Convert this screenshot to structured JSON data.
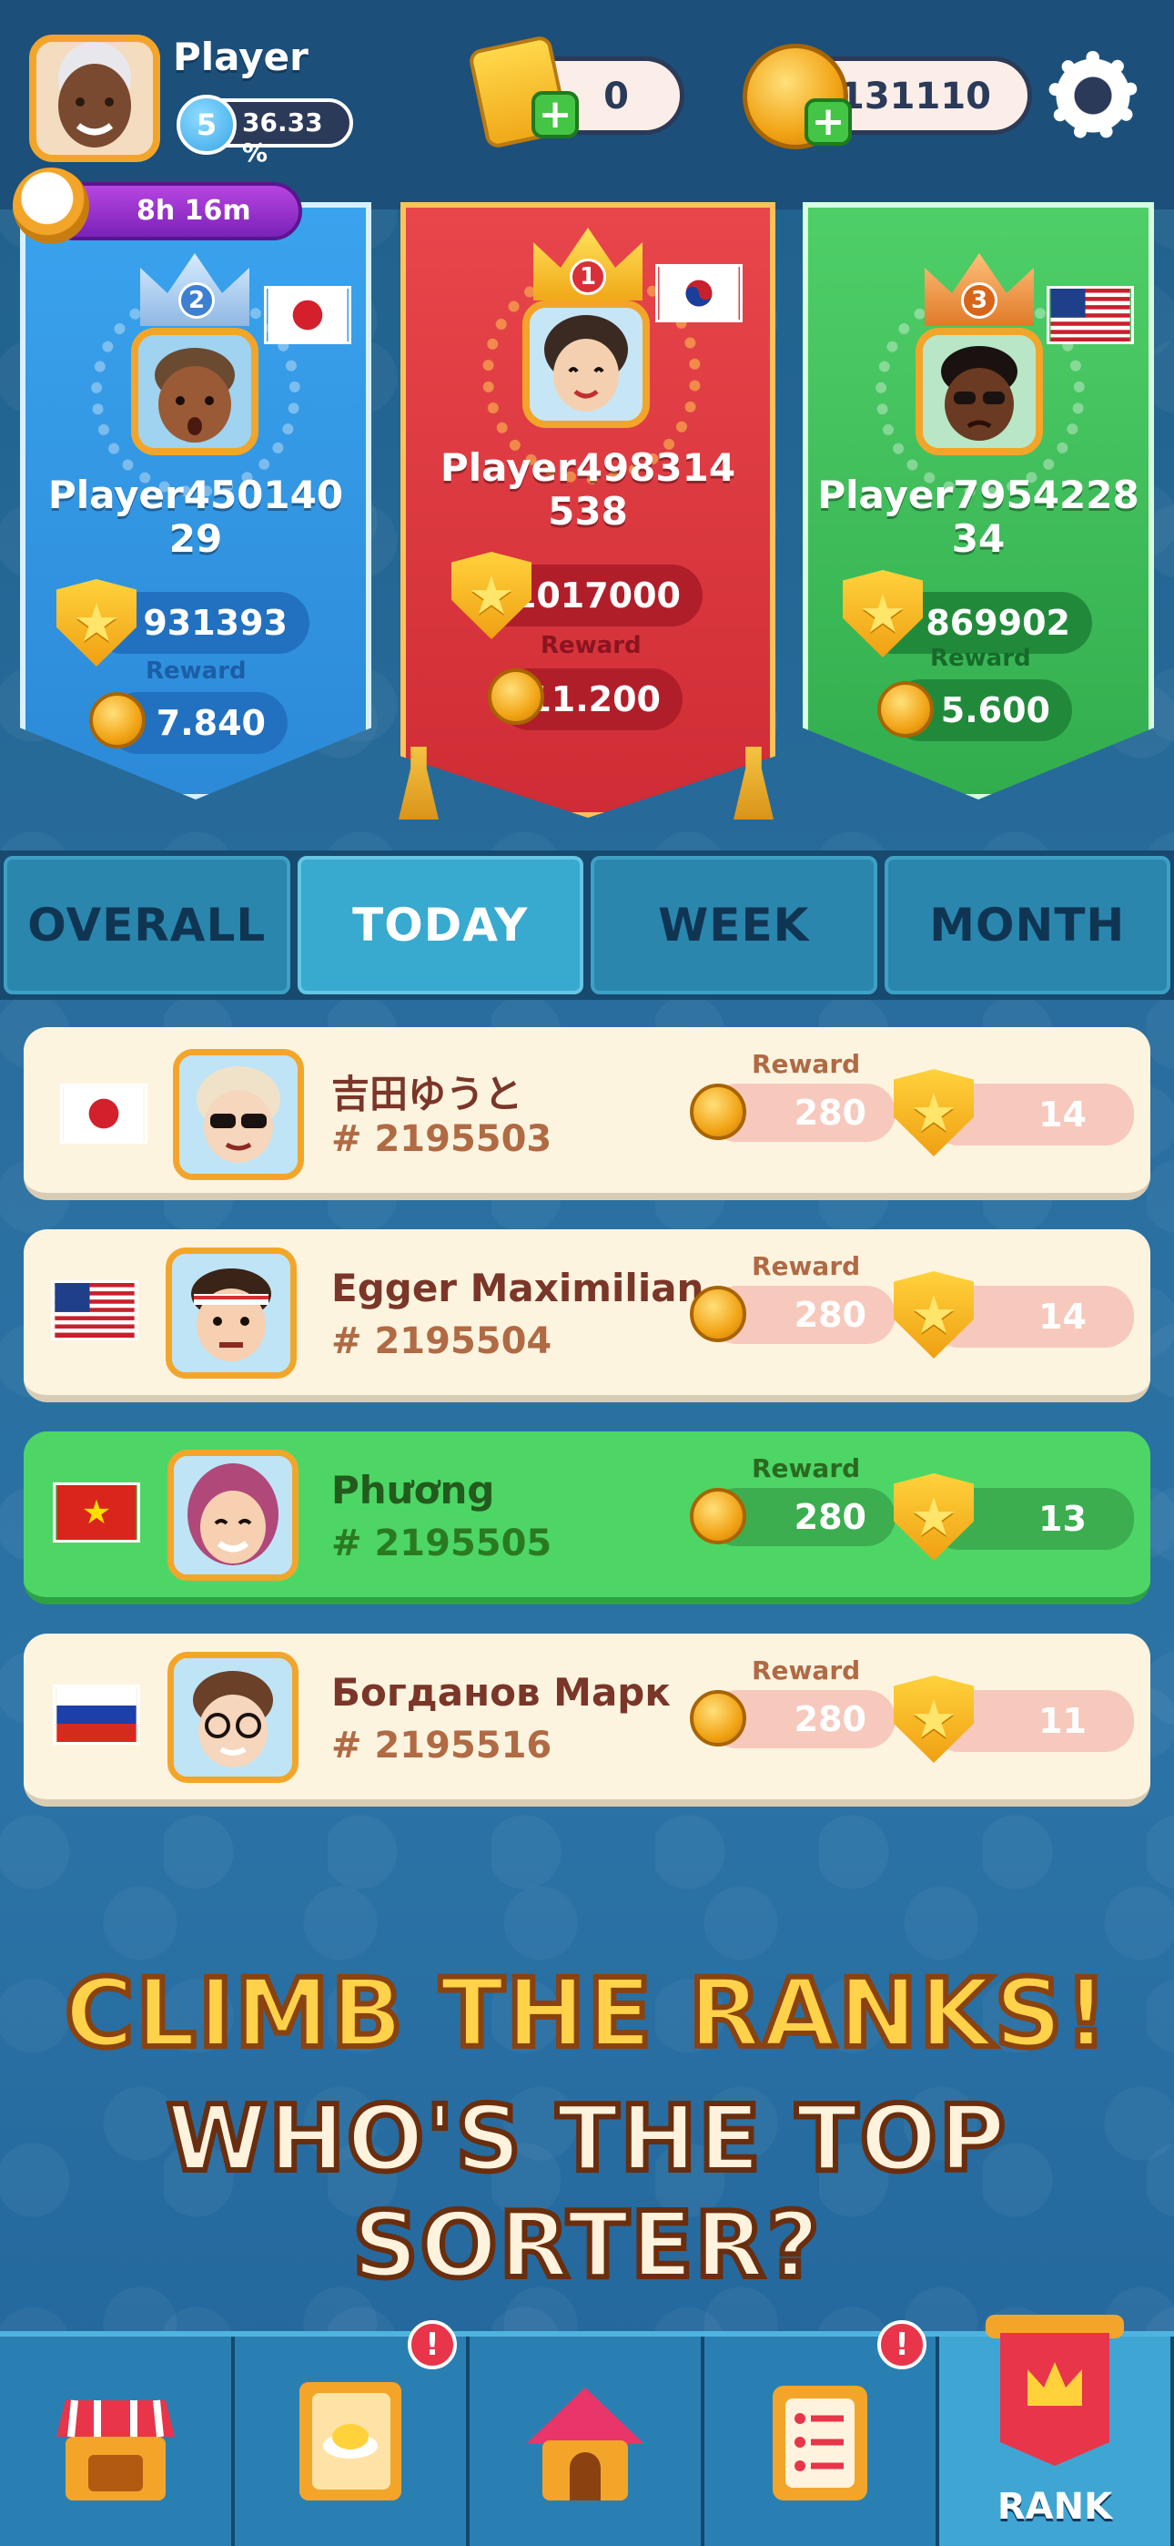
{
  "header": {
    "player_name": "Player",
    "level": "5",
    "level_progress": "36.33 %",
    "timer": "8h 16m",
    "tickets": "0",
    "coins": "131110",
    "icons": [
      "avatar",
      "stopwatch-icon",
      "ticket-icon",
      "plus-icon",
      "coin-icon",
      "gear-icon"
    ]
  },
  "podium": [
    {
      "rank": "2",
      "name": "Player45014029",
      "name_line1": "Player450140",
      "name_line2": "29",
      "score": "931393",
      "reward_label": "Reward",
      "reward": "7.840",
      "flag": "Japan",
      "color": "#2c8ad8"
    },
    {
      "rank": "1",
      "name": "Player498314538",
      "name_line1": "Player498314",
      "name_line2": "538",
      "score": "1017000",
      "reward_label": "Reward",
      "reward": "11.200",
      "flag": "South Korea",
      "color": "#cf2c35"
    },
    {
      "rank": "3",
      "name": "Player795422834",
      "name_line1": "Player7954228",
      "name_line2": "34",
      "score": "869902",
      "reward_label": "Reward",
      "reward": "5.600",
      "flag": "USA",
      "color": "#32ad4e"
    }
  ],
  "tabs": [
    {
      "label": "OVERALL",
      "active": false
    },
    {
      "label": "TODAY",
      "active": true
    },
    {
      "label": "WEEK",
      "active": false
    },
    {
      "label": "MONTH",
      "active": false
    }
  ],
  "list": [
    {
      "name": "吉田ゆうと",
      "id": "# 2195503",
      "reward_label": "Reward",
      "reward": "280",
      "score": "14",
      "flag": "Japan",
      "mine": false
    },
    {
      "name": "Egger Maximilian",
      "id": "# 2195504",
      "reward_label": "Reward",
      "reward": "280",
      "score": "14",
      "flag": "USA",
      "mine": false
    },
    {
      "name": "Phương",
      "id": "# 2195505",
      "reward_label": "Reward",
      "reward": "280",
      "score": "13",
      "flag": "Vietnam",
      "mine": true
    },
    {
      "name": "Богданов Марк",
      "id": "# 2195516",
      "reward_label": "Reward",
      "reward": "280",
      "score": "11",
      "flag": "Russia",
      "mine": false
    }
  ],
  "slogan": {
    "line1": "CLIMB THE RANKS!",
    "line2": "WHO'S THE TOP SORTER?"
  },
  "nav": {
    "items": [
      {
        "name": "shop",
        "icon": "shop-icon",
        "badge": ""
      },
      {
        "name": "recipes",
        "icon": "recipe-book-icon",
        "badge": "!"
      },
      {
        "name": "home",
        "icon": "home-icon",
        "badge": ""
      },
      {
        "name": "tasks",
        "icon": "checklist-icon",
        "badge": "!"
      },
      {
        "name": "rank",
        "icon": "rank-banner-icon",
        "badge": "",
        "label": "RANK"
      }
    ]
  },
  "colors": {
    "accent_gold": "#f3a52a",
    "bg_blue": "#22628f",
    "row_cream": "#fdf4e0",
    "row_mine_green": "#4dd665",
    "text_brown": "#7a3628"
  }
}
